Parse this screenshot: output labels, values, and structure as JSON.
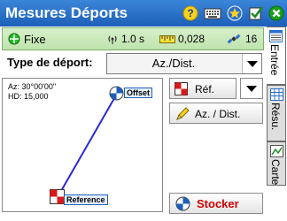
{
  "title": "Mesures Déports",
  "toolbar": {
    "icons": [
      "help-icon",
      "keyboard-icon",
      "favorites-star-icon",
      "check-icon",
      "close-icon"
    ]
  },
  "status": {
    "mode": "Fixe",
    "interval": "1.0 s",
    "precision": "0,028",
    "satellites": "16"
  },
  "type": {
    "label": "Type de déport:",
    "selected": "Az./Dist."
  },
  "graph": {
    "az": "Az: 30°00'00\"",
    "hd": "HD: 15,000",
    "offset_label": "Offset",
    "reference_label": "Reference"
  },
  "buttons": {
    "ref": "Réf.",
    "az_dist": "Az. / Dist.",
    "stocker": "Stocker"
  },
  "tabs": [
    "Entrée",
    "Résu.",
    "Carte"
  ],
  "colors": {
    "title_bar": "#1d5fb8",
    "status_bar": "#c8e8b8",
    "stocker_text": "#d00000",
    "line": "#2a2ad8"
  }
}
